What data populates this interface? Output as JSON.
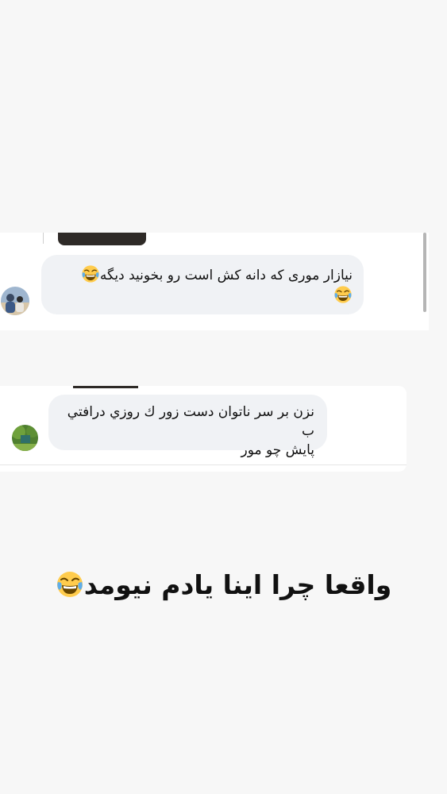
{
  "comments": [
    {
      "text": "نیازار موری که دانه کش است رو بخونید دیگه",
      "emoji_count": 2,
      "emoji_icon": "face-with-tears-of-joy-icon"
    },
    {
      "line1": "نزن بر سر ناتوان دست زور ك روزي درافتي ب",
      "line2": "پايش چو مور"
    }
  ],
  "caption": {
    "text": "واقعا چرا اینا یادم نیومد",
    "emoji_icon": "face-with-tears-of-joy-icon"
  },
  "colors": {
    "page_background": "#f7f7f7",
    "card_background": "#ffffff",
    "bubble_background": "#f0f2f5",
    "text": "#111111"
  }
}
